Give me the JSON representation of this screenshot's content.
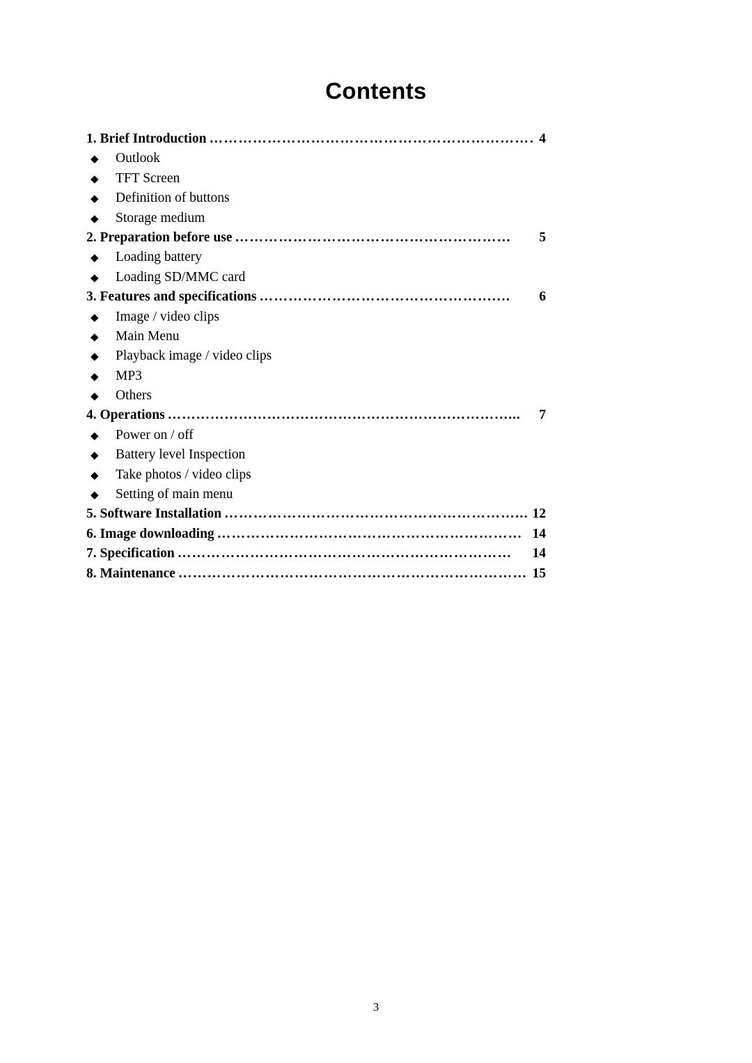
{
  "document": {
    "title": "Contents",
    "page_number": "3"
  },
  "toc": {
    "entries": [
      {
        "kind": "chapter",
        "label": "1. Brief Introduction",
        "leader": "……………………………………………………………………",
        "page": "4",
        "tight_leader": false,
        "nogap": false
      },
      {
        "kind": "bullet",
        "marker": "◆",
        "label": "Outlook"
      },
      {
        "kind": "bullet",
        "marker": "◆",
        "label": "TFT Screen"
      },
      {
        "kind": "bullet",
        "marker": "◆",
        "label": "Definition of buttons"
      },
      {
        "kind": "bullet",
        "marker": "◆",
        "label": "Storage medium"
      },
      {
        "kind": "chapter",
        "label": "2. Preparation before use",
        "leader": "…………………………………………………",
        "page": "5",
        "tight_leader": false,
        "nogap": false
      },
      {
        "kind": "bullet",
        "marker": "◆",
        "label": "Loading battery"
      },
      {
        "kind": "bullet",
        "marker": "◆",
        "label": "Loading SD/MMC card"
      },
      {
        "kind": "chapter",
        "label": "3. Features and specifications",
        "leader": "………………………………………….…",
        "page": "6",
        "tight_leader": false,
        "nogap": false
      },
      {
        "kind": "bullet",
        "marker": "◆",
        "label": "Image / video clips"
      },
      {
        "kind": "bullet",
        "marker": "◆",
        "label": "Main Menu"
      },
      {
        "kind": "bullet",
        "marker": "◆",
        "label": "Playback image / video clips"
      },
      {
        "kind": "bullet",
        "marker": "◆",
        "label": "MP3"
      },
      {
        "kind": "bullet",
        "marker": "◆",
        "label": "Others"
      },
      {
        "kind": "chapter",
        "label": "4. Operations",
        "leader": "………………………………………………………………...",
        "page": "7",
        "tight_leader": true,
        "nogap": true
      },
      {
        "kind": "bullet",
        "marker": "◆",
        "label": "Power on / off"
      },
      {
        "kind": "bullet",
        "marker": "◆",
        "label": "Battery level Inspection"
      },
      {
        "kind": "bullet",
        "marker": "◆",
        "label": "Take photos / video clips"
      },
      {
        "kind": "bullet",
        "marker": "◆",
        "label": "Setting of main menu"
      },
      {
        "kind": "chapter",
        "label": "5. Software Installation",
        "leader": "……………………………………………………...",
        "page": "12",
        "tight_leader": false,
        "nogap": false
      },
      {
        "kind": "chapter",
        "label": "6. Image downloading",
        "leader": "………………………………………………………",
        "page": "14",
        "tight_leader": false,
        "nogap": false
      },
      {
        "kind": "chapter",
        "label": "7. Specification",
        "leader": "……………………………………………………………",
        "page": "14",
        "tight_leader": false,
        "nogap": false
      },
      {
        "kind": "chapter",
        "label": "8. Maintenance",
        "leader": "………………………………………………………………",
        "page": "15",
        "tight_leader": false,
        "nogap": false
      }
    ]
  }
}
